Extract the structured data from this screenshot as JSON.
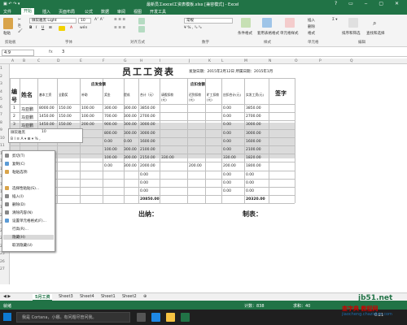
{
  "window": {
    "title": "最新员工excel工资表模板.xlsx [兼容模式] - Excel",
    "quick_access": "▣ ↶ ↷ ▾"
  },
  "ribbon_tabs": [
    "文件",
    "开始",
    "插入",
    "页面布局",
    "公式",
    "数据",
    "审阅",
    "视图",
    "开发工具"
  ],
  "ribbon": {
    "font_name": "微软雅黑 Light",
    "font_size": "10",
    "number_format": "常规",
    "paste_label": "粘贴",
    "clipboard_group": "剪贴板",
    "font_group": "字体",
    "align_group": "对齐方式",
    "number_group": "数字",
    "style_group": "样式",
    "cells_group": "单元格",
    "edit_group": "编辑",
    "cond_format": "条件格式",
    "table_format": "套用表格格式",
    "cell_style": "单元格样式",
    "insert": "插入",
    "delete": "删除",
    "format": "格式",
    "sort": "排序和筛选",
    "find": "查找和选择"
  },
  "formula_bar": {
    "name_box": "4:9",
    "fx": "fx",
    "value": "3"
  },
  "columns": [
    "A",
    "B",
    "C",
    "D",
    "E",
    "F",
    "G",
    "H",
    "I",
    "J",
    "K",
    "L",
    "M",
    "N",
    "O",
    "P",
    "Q"
  ],
  "rows": [
    "1",
    "2",
    "3",
    "4",
    "5",
    "6",
    "7",
    "8",
    "9",
    "10",
    "11",
    "12",
    "13",
    "14",
    "15",
    "16",
    "17",
    "18",
    "19",
    "20",
    "21",
    "22",
    "23",
    "24",
    "25",
    "26",
    "27"
  ],
  "sheet": {
    "title": "员工工资表",
    "issue_date": "发放日期：2015年2月12日  所属日期：2015年1月",
    "header_no": "编号",
    "header_name": "姓名",
    "group_should": "应发金额",
    "group_deduct": "应扣金额",
    "sub_headers": [
      "基本工资",
      "全勤奖",
      "补助",
      "奖金",
      "提成",
      "合计（元）",
      "请假扣款(元)",
      "迟到扣款(元)",
      "旷工扣款(元)",
      "应扣合计(元)",
      "实发工资(元)"
    ],
    "header_sign": "签字",
    "data_rows": [
      {
        "no": "1",
        "name": "马亚鹏",
        "v": [
          "8000.00",
          "150.00",
          "100.00",
          "300.00",
          "300.00",
          "3850.00",
          "",
          "",
          "",
          "0.00",
          "3850.00"
        ]
      },
      {
        "no": "2",
        "name": "马亚鹏",
        "v": [
          "1450.00",
          "150.00",
          "100.00",
          "700.00",
          "300.00",
          "2700.00",
          "",
          "",
          "",
          "0.00",
          "2700.00"
        ]
      },
      {
        "no": "3",
        "name": "马亚鹏",
        "v": [
          "1450.00",
          "150.00",
          "200.00",
          "900.00",
          "300.00",
          "3000.00",
          "",
          "",
          "",
          "0.00",
          "3000.00"
        ]
      },
      {
        "no": "4",
        "name": "",
        "v": [
          "",
          "",
          "",
          "800.00",
          "300.00",
          "3000.00",
          "",
          "",
          "",
          "0.00",
          "3000.00"
        ]
      },
      {
        "no": "",
        "name": "",
        "v": [
          "",
          "",
          "",
          "0.00",
          "0.00",
          "1600.00",
          "",
          "",
          "",
          "0.00",
          "1600.00"
        ]
      },
      {
        "no": "",
        "name": "",
        "v": [
          "",
          "",
          "",
          "100.00",
          "300.00",
          "2100.00",
          "",
          "",
          "",
          "0.00",
          "2100.00"
        ]
      },
      {
        "no": "",
        "name": "",
        "v": [
          "",
          "",
          "",
          "100.00",
          "300.00",
          "2150.00",
          "330.00",
          "",
          "",
          "330.00",
          "1820.00"
        ]
      },
      {
        "no": "",
        "name": "",
        "v": [
          "",
          "",
          "",
          "0.00",
          "300.00",
          "2000.00",
          "",
          "200.00",
          "",
          "200.00",
          "1800.00"
        ]
      },
      {
        "no": "",
        "name": "",
        "v": [
          "",
          "",
          "",
          "",
          "",
          "0.00",
          "",
          "",
          "",
          "0.00",
          "0.00"
        ]
      },
      {
        "no": "",
        "name": "",
        "v": [
          "",
          "",
          "",
          "",
          "",
          "0.00",
          "",
          "",
          "",
          "0.00",
          "0.00"
        ]
      },
      {
        "no": "",
        "name": "",
        "v": [
          "",
          "",
          "",
          "",
          "",
          "0.00",
          "",
          "",
          "",
          "0.00",
          "0.00"
        ]
      }
    ],
    "total": {
      "v": [
        "",
        "",
        "",
        "",
        "",
        "20850.00",
        "",
        "",
        "",
        "",
        "20320.00"
      ]
    },
    "cashier": "出纳：",
    "preparer": "制表："
  },
  "minibar": {
    "font": "微软雅黑",
    "size": "10",
    "row2": "B I ≡ A ▾ ⊞ ▾ % ,"
  },
  "context_menu": [
    "剪切(T)",
    "复制(C)",
    "粘贴选项:",
    "",
    "选择性粘贴(S)...",
    "插入(I)",
    "删除(D)",
    "清除内容(N)",
    "设置单元格格式(F)...",
    "行高(R)...",
    "隐藏(H)",
    "取消隐藏(U)"
  ],
  "context_highlight_index": 10,
  "sheet_tabs": [
    "5月工资",
    "Sheet3",
    "Sheet4",
    "Sheet1",
    "Sheet2"
  ],
  "status": {
    "left": "就绪",
    "count": "计数：838",
    "sum": "求和：40"
  },
  "taskbar": {
    "cortana": "我是 Cortana，小娜。有问题尽管问我。",
    "time": "0:21"
  },
  "watermark": {
    "a": "jb51.net",
    "b": "查字典 教程网",
    "c": "jiaocheng.chazidian.com"
  },
  "colors": {
    "excel_green": "#217346",
    "select_gray": "#bdbdbd"
  }
}
